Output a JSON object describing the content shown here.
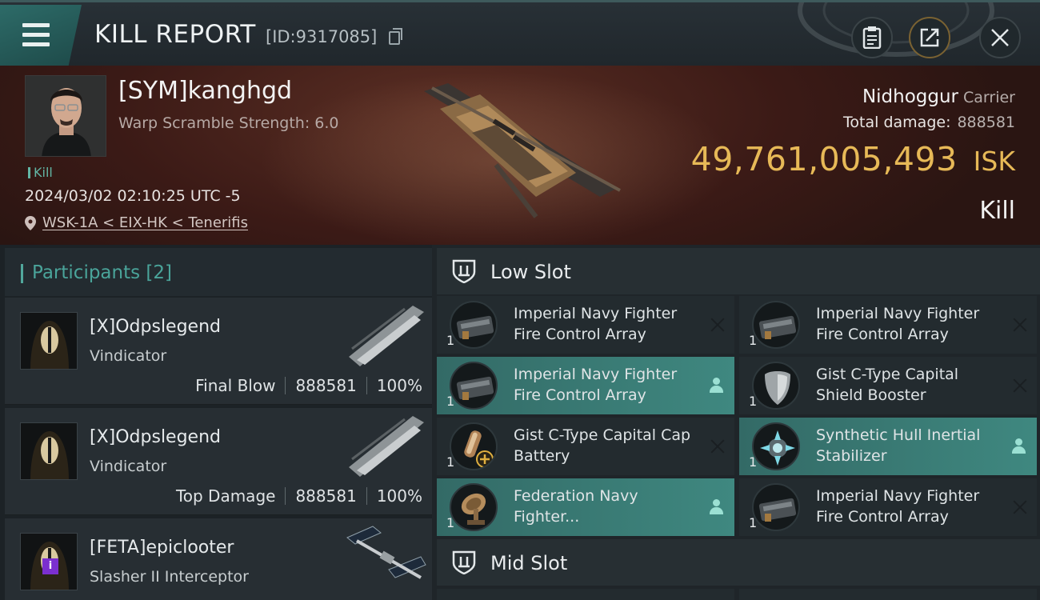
{
  "header": {
    "title": "KILL REPORT",
    "id_text": "[ID:9317085]",
    "icons": [
      "menu-icon",
      "copy-icon",
      "clipboard-icon",
      "share-icon",
      "close-icon"
    ]
  },
  "victim": {
    "name": "[SYM]kanghgd",
    "subtitle": "Warp Scramble Strength: 6.0",
    "tag": "Kill",
    "datetime": "2024/03/02 02:10:25 UTC -5",
    "location": "WSK-1A < EIX-HK < Tenerifis",
    "ship": "Nidhoggur",
    "ship_class": "Carrier",
    "total_damage_label": "Total damage:",
    "total_damage": "888581",
    "isk_value": "49,761,005,493",
    "isk_unit": "ISK",
    "kill_type": "Kill"
  },
  "participants": {
    "label": "Participants",
    "count": "[2]",
    "rows": [
      {
        "name": "[X]Odpslegend",
        "ship": "Vindicator",
        "role": "Final Blow",
        "damage": "888581",
        "percent": "100%"
      },
      {
        "name": "[X]Odpslegend",
        "ship": "Vindicator",
        "role": "Top Damage",
        "damage": "888581",
        "percent": "100%"
      },
      {
        "name": "[FETA]epiclooter",
        "ship": "Slasher II Interceptor",
        "badge": "i"
      }
    ]
  },
  "low_slot": {
    "label": "Low Slot",
    "modules": [
      {
        "name": "Imperial Navy Fighter Fire Control Array",
        "qty": "1",
        "status": "destroyed"
      },
      {
        "name": "Imperial Navy Fighter Fire Control Array",
        "qty": "1",
        "status": "destroyed"
      },
      {
        "name": "Imperial Navy Fighter Fire Control Array",
        "qty": "1",
        "status": "dropped"
      },
      {
        "name": "Gist C-Type Capital Shield Booster",
        "qty": "1",
        "status": "destroyed"
      },
      {
        "name": "Gist C-Type Capital Cap Battery",
        "qty": "1",
        "status": "destroyed"
      },
      {
        "name": "Synthetic Hull Inertial Stabilizer",
        "qty": "1",
        "status": "dropped"
      },
      {
        "name": "Federation Navy Fighter...",
        "qty": "1",
        "status": "dropped"
      },
      {
        "name": "Imperial Navy Fighter Fire Control Array",
        "qty": "1",
        "status": "destroyed"
      }
    ]
  },
  "mid_slot": {
    "label": "Mid Slot"
  },
  "colors": {
    "accent_teal": "#3f8880",
    "isk_gold": "#e7b957",
    "badge_purple": "#7b2fd0"
  }
}
